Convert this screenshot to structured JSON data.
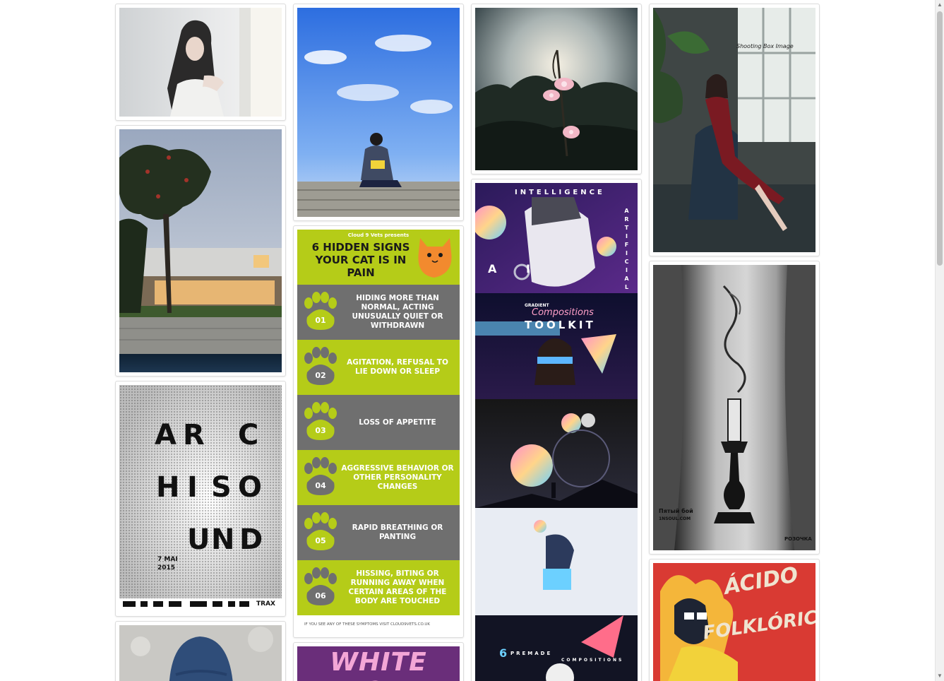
{
  "gallery": {
    "cards": {
      "cat_poster": {
        "presenter": "Cloud 9 Vets presents",
        "title": "6 HIDDEN SIGNS YOUR CAT IS IN PAIN",
        "signs": [
          {
            "num": "01",
            "text": "HIDING MORE THAN NORMAL, ACTING UNUSUALLY QUIET OR WITHDRAWN"
          },
          {
            "num": "02",
            "text": "AGITATION, REFUSAL TO LIE DOWN OR SLEEP"
          },
          {
            "num": "03",
            "text": "LOSS OF APPETITE"
          },
          {
            "num": "04",
            "text": "AGGRESSIVE BEHAVIOR OR OTHER PERSONALITY CHANGES"
          },
          {
            "num": "05",
            "text": "RAPID BREATHING OR PANTING"
          },
          {
            "num": "06",
            "text": "HISSING, BITING OR RUNNING AWAY WHEN CERTAIN AREAS OF THE BODY ARE TOUCHED"
          }
        ],
        "footer": "IF YOU SEE ANY OF THESE SYMPTOMS VISIT CLOUD9VETS.CO.UK"
      },
      "archisound_poster": {
        "letters": [
          "A",
          "R",
          "C",
          "H",
          "I",
          "S",
          "O",
          "U",
          "N",
          "D"
        ],
        "date_line1": "7 MAI",
        "date_line2": "2015",
        "footer_brand": "TRAX"
      },
      "ai_poster": {
        "top_word": "INTELLIGENCE",
        "side_word": "ARTIFICIAL",
        "letters": "A I",
        "toolkit_small": "GRADIENT",
        "toolkit_script": "Compositions",
        "toolkit_word": "TOOLKIT",
        "premade_num": "6",
        "premade_word": "PREMADE",
        "compositions_word": "COMPOSITIONS"
      },
      "chair_photo": {
        "caption": "Shooting Box Image"
      },
      "tattoo_photo": {
        "artist": "Пятый бой",
        "site": "1NSOUL.COM",
        "brand": "РОЗОЧКА"
      },
      "acido_poster": {
        "title_line1": "ÁCIDO",
        "title_line2": "FOLKLÓRICO"
      },
      "white_acid_poster": {
        "title": "WHITE ACID"
      }
    }
  },
  "colors": {
    "lime": "#b5cc18",
    "gray_band": "#6f6f6f",
    "cat_orange": "#f28a2e"
  },
  "icons": {
    "paw": "paw-icon",
    "scroll_up": "arrow-up-icon",
    "scroll_down": "arrow-down-icon"
  }
}
